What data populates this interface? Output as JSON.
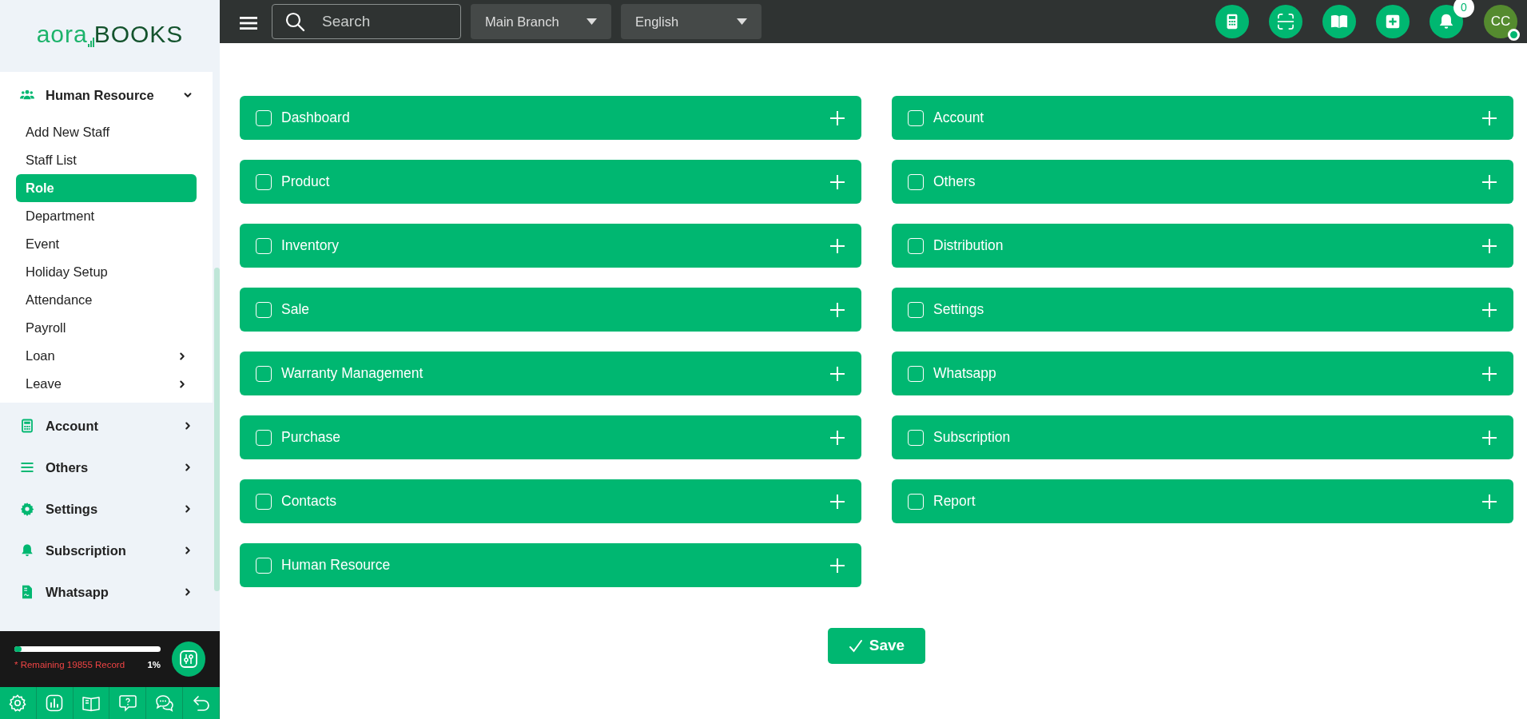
{
  "logo": {
    "part1": "aora",
    "part2": "BOOKS"
  },
  "topbar": {
    "search": {
      "placeholder": "Search"
    },
    "dropdowns": [
      {
        "value": "Main Branch"
      },
      {
        "value": "English"
      }
    ],
    "actions": [
      {
        "kind": "calculator"
      },
      {
        "kind": "scan"
      },
      {
        "kind": "book"
      },
      {
        "kind": "add"
      },
      {
        "kind": "bell",
        "badge": "0"
      }
    ],
    "avatar": {
      "initials": "CC",
      "online": true
    }
  },
  "sidebar": {
    "groups": [
      {
        "label": "Human Resource",
        "kind": "users",
        "expanded": true,
        "children": [
          {
            "label": "Add New Staff",
            "selected": false,
            "submenu": false
          },
          {
            "label": "Staff List",
            "selected": false,
            "submenu": false
          },
          {
            "label": "Role",
            "selected": true,
            "submenu": false
          },
          {
            "label": "Department",
            "selected": false,
            "submenu": false
          },
          {
            "label": "Event",
            "selected": false,
            "submenu": false
          },
          {
            "label": "Holiday Setup",
            "selected": false,
            "submenu": false
          },
          {
            "label": "Attendance",
            "selected": false,
            "submenu": false
          },
          {
            "label": "Payroll",
            "selected": false,
            "submenu": false
          },
          {
            "label": "Loan",
            "selected": false,
            "submenu": true
          },
          {
            "label": "Leave",
            "selected": false,
            "submenu": true
          }
        ]
      },
      {
        "label": "Account",
        "kind": "calculator",
        "expanded": false
      },
      {
        "label": "Others",
        "kind": "list",
        "expanded": false
      },
      {
        "label": "Settings",
        "kind": "gear",
        "expanded": false
      },
      {
        "label": "Subscription",
        "kind": "bell",
        "expanded": false
      },
      {
        "label": "Whatsapp",
        "kind": "document",
        "expanded": false
      }
    ]
  },
  "usage": {
    "level": 0.05,
    "note": "* Remaining 19855 Record",
    "reading": "1%"
  },
  "footer_tools": [
    {
      "kind": "gear"
    },
    {
      "kind": "chart"
    },
    {
      "kind": "book"
    },
    {
      "kind": "help"
    },
    {
      "kind": "chat"
    },
    {
      "kind": "back"
    }
  ],
  "modules": {
    "columns": [
      [
        {
          "label": "Dashboard",
          "checked": false,
          "expanded": false
        },
        {
          "label": "Product",
          "checked": false,
          "expanded": false
        },
        {
          "label": "Inventory",
          "checked": false,
          "expanded": false
        },
        {
          "label": "Sale",
          "checked": false,
          "expanded": false
        },
        {
          "label": "Warranty Management",
          "checked": false,
          "expanded": false
        },
        {
          "label": "Purchase",
          "checked": false,
          "expanded": false
        },
        {
          "label": "Contacts",
          "checked": false,
          "expanded": false
        },
        {
          "label": "Human Resource",
          "checked": false,
          "expanded": false
        }
      ],
      [
        {
          "label": "Account",
          "checked": false,
          "expanded": false
        },
        {
          "label": "Others",
          "checked": false,
          "expanded": false
        },
        {
          "label": "Distribution",
          "checked": false,
          "expanded": false
        },
        {
          "label": "Settings",
          "checked": false,
          "expanded": false
        },
        {
          "label": "Whatsapp",
          "checked": false,
          "expanded": false
        },
        {
          "label": "Subscription",
          "checked": false,
          "expanded": false
        },
        {
          "label": "Report",
          "checked": false,
          "expanded": false
        }
      ]
    ]
  },
  "save_button": {
    "label": "Save"
  }
}
